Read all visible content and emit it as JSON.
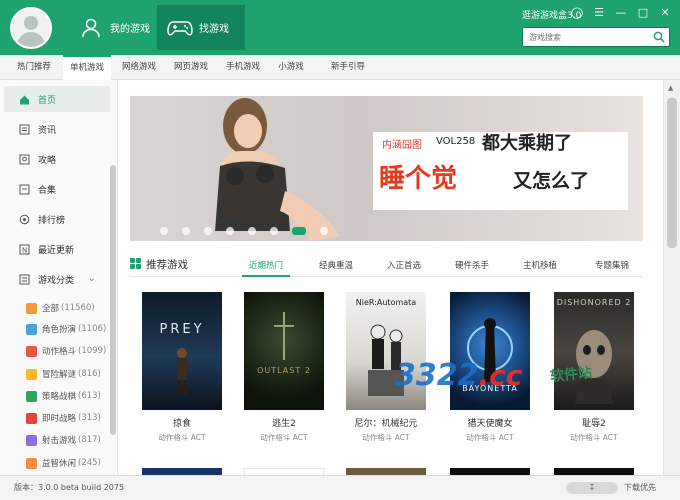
{
  "header": {
    "tabs": [
      {
        "label": "我的游戏",
        "icon": "user-icon"
      },
      {
        "label": "找游戏",
        "icon": "gamepad-icon"
      }
    ],
    "brand": "逛游游戏盒3.0",
    "search_placeholder": "游戏搜索",
    "colors": {
      "accent": "#1fa36e",
      "accent_dark": "#13855a"
    }
  },
  "subnav": [
    "热门推荐",
    "单机游戏",
    "网络游戏",
    "网页游戏",
    "手机游戏",
    "小游戏",
    "新手引导"
  ],
  "subnav_active": "单机游戏",
  "sidebar": {
    "items": [
      {
        "label": "首页",
        "icon": "home-icon"
      },
      {
        "label": "资讯",
        "icon": "news-icon"
      },
      {
        "label": "攻略",
        "icon": "guide-icon"
      },
      {
        "label": "合集",
        "icon": "collection-icon"
      },
      {
        "label": "排行榜",
        "icon": "ranking-icon"
      },
      {
        "label": "最近更新",
        "icon": "new-icon"
      },
      {
        "label": "游戏分类",
        "icon": "category-icon"
      }
    ],
    "categories": [
      {
        "label": "全部",
        "count": "(11560)",
        "color": "#f29b34"
      },
      {
        "label": "角色扮演",
        "count": "(1106)",
        "color": "#4aa3df"
      },
      {
        "label": "动作格斗",
        "count": "(1099)",
        "color": "#e9554c"
      },
      {
        "label": "冒险解谜",
        "count": "(816)",
        "color": "#f5b82e"
      },
      {
        "label": "策略战棋",
        "count": "(613)",
        "color": "#2fa35a"
      },
      {
        "label": "即时战略",
        "count": "(313)",
        "color": "#e2463b"
      },
      {
        "label": "射击游戏",
        "count": "(817)",
        "color": "#8a6de0"
      },
      {
        "label": "益智休闲",
        "count": "(245)",
        "color": "#f0903a"
      }
    ]
  },
  "banner": {
    "tag": "内涵囧图",
    "vol": "VOL258",
    "line1": "都大乘期了",
    "line2a": "睡个觉",
    "line2b": "又怎么了"
  },
  "recommend": {
    "title": "推荐游戏",
    "tabs": [
      "近期热门",
      "经典重温",
      "入正首选",
      "硬件杀手",
      "主机移植",
      "专题集锦"
    ]
  },
  "cards": [
    {
      "cover_text": "PREY",
      "name": "掠食",
      "genre": "动作格斗 ACT"
    },
    {
      "cover_text": "OUTLAST 2",
      "name": "逃生2",
      "genre": "动作格斗 ACT"
    },
    {
      "cover_text": "NieR:Automata",
      "name": "尼尔：机械纪元",
      "genre": "动作格斗 ACT"
    },
    {
      "cover_text": "BAYONETTA",
      "name": "猎天使魔女",
      "genre": "动作格斗 ACT"
    },
    {
      "cover_text": "DISHONORED 2",
      "name": "耻辱2",
      "genre": "动作格斗 ACT"
    }
  ],
  "watermark": {
    "text": "3322",
    "suffix": ".cc",
    "site": "软件站"
  },
  "footer": {
    "version": "版本：3.0.0 beta build 2075",
    "download_priority": "下载优先"
  }
}
